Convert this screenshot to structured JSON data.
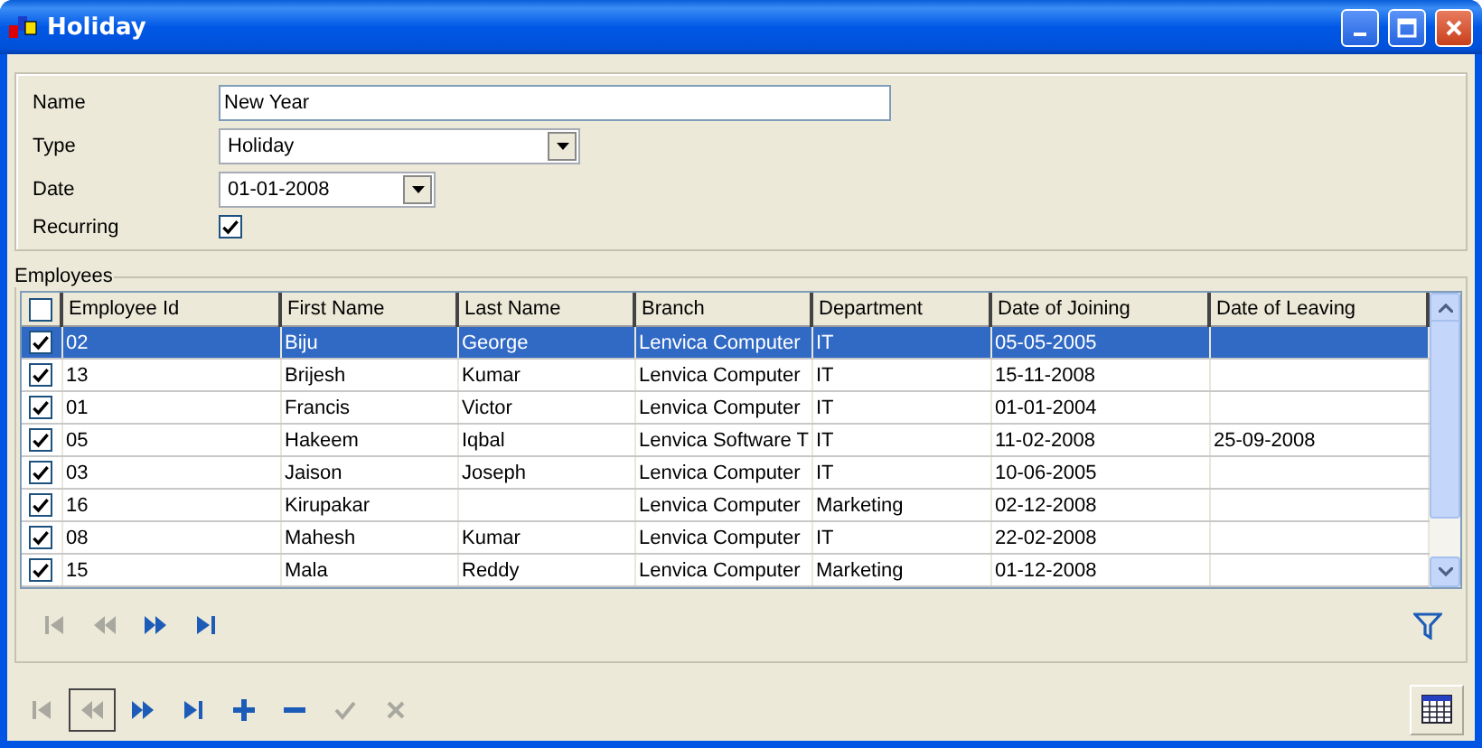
{
  "window": {
    "title": "Holiday"
  },
  "form": {
    "name_label": "Name",
    "name_value": "New Year",
    "type_label": "Type",
    "type_value": "Holiday",
    "date_label": "Date",
    "date_value": "01-01-2008",
    "recurring_label": "Recurring",
    "recurring_checked": true
  },
  "employees": {
    "title": "Employees",
    "header_checked": false,
    "columns": [
      "Employee Id",
      "First Name",
      "Last Name",
      "Branch",
      "Department",
      "Date of Joining",
      "Date of Leaving"
    ],
    "rows": [
      {
        "checked": true,
        "selected": true,
        "cells": [
          "02",
          "Biju",
          "George",
          "Lenvica Computer",
          "IT",
          "05-05-2005",
          ""
        ]
      },
      {
        "checked": true,
        "selected": false,
        "cells": [
          "13",
          "Brijesh",
          "Kumar",
          "Lenvica Computer",
          "IT",
          "15-11-2008",
          ""
        ]
      },
      {
        "checked": true,
        "selected": false,
        "cells": [
          "01",
          "Francis",
          "Victor",
          "Lenvica Computer",
          "IT",
          "01-01-2004",
          ""
        ]
      },
      {
        "checked": true,
        "selected": false,
        "cells": [
          "05",
          "Hakeem",
          "Iqbal",
          "Lenvica Software T",
          "IT",
          "11-02-2008",
          "25-09-2008"
        ]
      },
      {
        "checked": true,
        "selected": false,
        "cells": [
          "03",
          "Jaison",
          "Joseph",
          "Lenvica Computer",
          "IT",
          "10-06-2005",
          ""
        ]
      },
      {
        "checked": true,
        "selected": false,
        "cells": [
          "16",
          "Kirupakar",
          "",
          "Lenvica Computer",
          "Marketing",
          "02-12-2008",
          ""
        ]
      },
      {
        "checked": true,
        "selected": false,
        "cells": [
          "08",
          "Mahesh",
          "Kumar",
          "Lenvica Computer",
          "IT",
          "22-02-2008",
          ""
        ]
      },
      {
        "checked": true,
        "selected": false,
        "cells": [
          "15",
          "Mala",
          "Reddy",
          "Lenvica Computer",
          "Marketing",
          "01-12-2008",
          ""
        ]
      }
    ],
    "navigator": [
      {
        "kind": "first",
        "disabled": true
      },
      {
        "kind": "prev",
        "disabled": true
      },
      {
        "kind": "next",
        "disabled": false
      },
      {
        "kind": "last",
        "disabled": false
      }
    ]
  },
  "toolbar": [
    {
      "kind": "first",
      "disabled": true
    },
    {
      "kind": "prev",
      "disabled": true
    },
    {
      "kind": "next",
      "disabled": false
    },
    {
      "kind": "last",
      "disabled": false
    },
    {
      "kind": "add",
      "disabled": false
    },
    {
      "kind": "remove",
      "disabled": false
    },
    {
      "kind": "confirm",
      "disabled": true
    },
    {
      "kind": "cancel",
      "disabled": true
    }
  ]
}
